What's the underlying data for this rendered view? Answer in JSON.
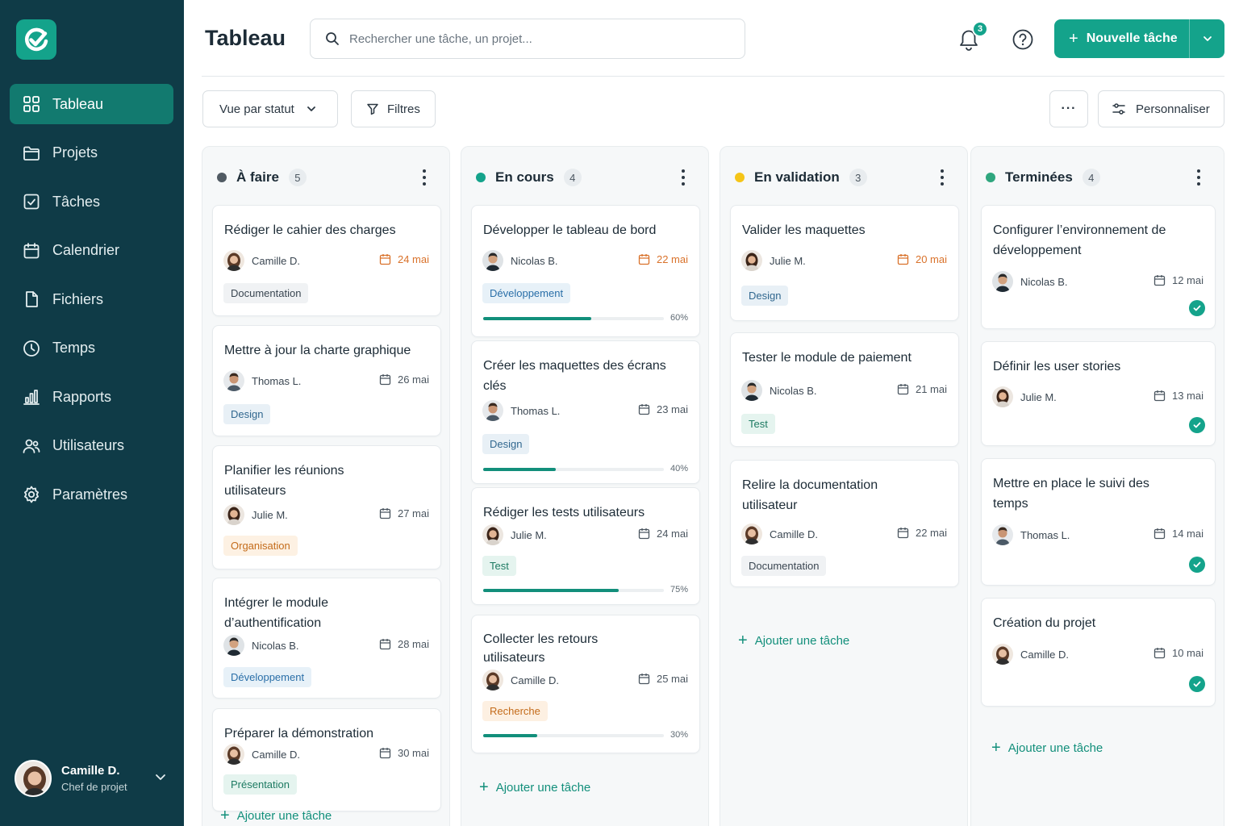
{
  "sidebar": {
    "items": [
      {
        "label": "Tableau",
        "icon": "grid-icon",
        "active": true
      },
      {
        "label": "Projets",
        "icon": "folder-icon"
      },
      {
        "label": "Tâches",
        "icon": "checkbox-icon"
      },
      {
        "label": "Calendrier",
        "icon": "calendar-icon"
      },
      {
        "label": "Fichiers",
        "icon": "file-icon"
      },
      {
        "label": "Temps",
        "icon": "clock-icon"
      },
      {
        "label": "Rapports",
        "icon": "bar-chart-icon"
      },
      {
        "label": "Utilisateurs",
        "icon": "users-icon"
      },
      {
        "label": "Paramètres",
        "icon": "gear-icon"
      }
    ],
    "user": {
      "name": "Camille D.",
      "role": "Chef de projet"
    }
  },
  "header": {
    "title": "Tableau",
    "search_placeholder": "Rechercher une tâche, un projet...",
    "notification_count": "3",
    "new_task_label": "Nouvelle tâche"
  },
  "toolbar": {
    "view_label": "Vue par statut",
    "filter_label": "Filtres",
    "more_label": "···",
    "customize_label": "Personnaliser"
  },
  "colors": {
    "accent": "#14a38b",
    "sidebar": "#0f3b47",
    "todo": "#505a63",
    "in_progress": "#14a38b",
    "validation": "#f5c518",
    "done": "#2fa67e",
    "late": "#d9722b"
  },
  "add_task_label": "Ajouter une tâche",
  "columns": [
    {
      "title": "À faire",
      "count": "5",
      "cards": [
        {
          "title": "Rédiger le cahier des charges",
          "assignee": "Camille D.",
          "due": "24 mai",
          "tag": "Documentation"
        },
        {
          "title": "Mettre à jour la charte graphique",
          "assignee": "Thomas L.",
          "due": "26 mai",
          "tag": "Design"
        },
        {
          "title": "Planifier les réunions utilisateurs",
          "assignee": "Julie M.",
          "due": "27 mai",
          "tag": "Organisation"
        },
        {
          "title": "Intégrer le module d’authentification",
          "assignee": "Nicolas B.",
          "due": "28 mai",
          "tag": "Développement"
        },
        {
          "title": "Préparer la démonstration",
          "assignee": "Camille D.",
          "due": "30 mai",
          "tag": "Présentation"
        }
      ]
    },
    {
      "title": "En cours",
      "count": "4",
      "cards": [
        {
          "title": "Développer le tableau de bord",
          "assignee": "Nicolas B.",
          "due": "22 mai",
          "tag": "Développement",
          "progress": 60,
          "progress_label": "60%"
        },
        {
          "title": "Créer les maquettes des écrans clés",
          "assignee": "Thomas L.",
          "due": "23 mai",
          "tag": "Design",
          "progress": 40,
          "progress_label": "40%"
        },
        {
          "title": "Rédiger les tests utilisateurs",
          "assignee": "Julie M.",
          "due": "24 mai",
          "tag": "Test",
          "progress": 75,
          "progress_label": "75%"
        },
        {
          "title": "Collecter les retours utilisateurs",
          "assignee": "Camille D.",
          "due": "25 mai",
          "tag": "Recherche",
          "progress": 30,
          "progress_label": "30%"
        }
      ]
    },
    {
      "title": "En validation",
      "count": "3",
      "cards": [
        {
          "title": "Valider les maquettes",
          "assignee": "Julie M.",
          "due": "20 mai",
          "tag": "Design"
        },
        {
          "title": "Tester le module de paiement",
          "assignee": "Nicolas B.",
          "due": "21 mai",
          "tag": "Test"
        },
        {
          "title": "Relire la documentation utilisateur",
          "assignee": "Camille D.",
          "due": "22 mai",
          "tag": "Documentation"
        }
      ]
    },
    {
      "title": "Terminées",
      "count": "4",
      "cards": [
        {
          "title": "Configurer l’environnement de développement",
          "assignee": "Nicolas B.",
          "due": "12 mai"
        },
        {
          "title": "Définir les user stories",
          "assignee": "Julie M.",
          "due": "13 mai"
        },
        {
          "title": "Mettre en place le suivi des temps",
          "assignee": "Thomas L.",
          "due": "14 mai"
        },
        {
          "title": "Création du projet",
          "assignee": "Camille D.",
          "due": "10 mai"
        }
      ]
    }
  ]
}
